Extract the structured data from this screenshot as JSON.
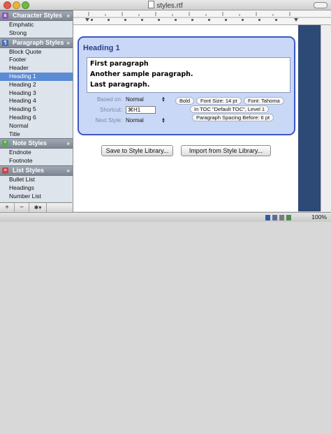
{
  "window": {
    "title": "styles.rtf"
  },
  "sidebar": {
    "sections": [
      {
        "title": "Character Styles",
        "icon": "character-style-icon",
        "items": [
          "Emphatic",
          "Strong"
        ]
      },
      {
        "title": "Paragraph Styles",
        "icon": "paragraph-style-icon",
        "items": [
          "Block Quote",
          "Footer",
          "Header",
          "Heading 1",
          "Heading 2",
          "Heading 3",
          "Heading 4",
          "Heading 5",
          "Heading 6",
          "Normal",
          "Title"
        ],
        "selected": "Heading 1"
      },
      {
        "title": "Note Styles",
        "icon": "note-style-icon",
        "items": [
          "Endnote",
          "Footnote"
        ]
      },
      {
        "title": "List Styles",
        "icon": "list-style-icon",
        "items": [
          "Bullet List",
          "Headings",
          "Number List"
        ]
      }
    ],
    "bottom_bar": {
      "add": "+",
      "remove": "−",
      "action": "✱▾"
    }
  },
  "style_panel": {
    "name": "Heading 1",
    "preview_lines": [
      "First paragraph",
      "Another sample paragraph.",
      "Last paragraph."
    ],
    "based_on": {
      "label": "Based on:",
      "value": "Normal"
    },
    "shortcut": {
      "label": "Shortcut:",
      "value": "⌘H1"
    },
    "next_style": {
      "label": "Next Style:",
      "value": "Normal"
    },
    "attributes": [
      "Bold",
      "Font Size: 14 pt",
      "Font: Tahoma",
      "In TOC \"Default TOC\", Level 1",
      "Paragraph Spacing Before: 6 pt"
    ]
  },
  "buttons": {
    "save": "Save to Style Library...",
    "import": "Import from Style Library..."
  },
  "status": {
    "zoom": "100%"
  },
  "colors": {
    "accent": "#3c56c5",
    "selection": "#5a8bd4",
    "page_edge": "#2d4a76"
  }
}
